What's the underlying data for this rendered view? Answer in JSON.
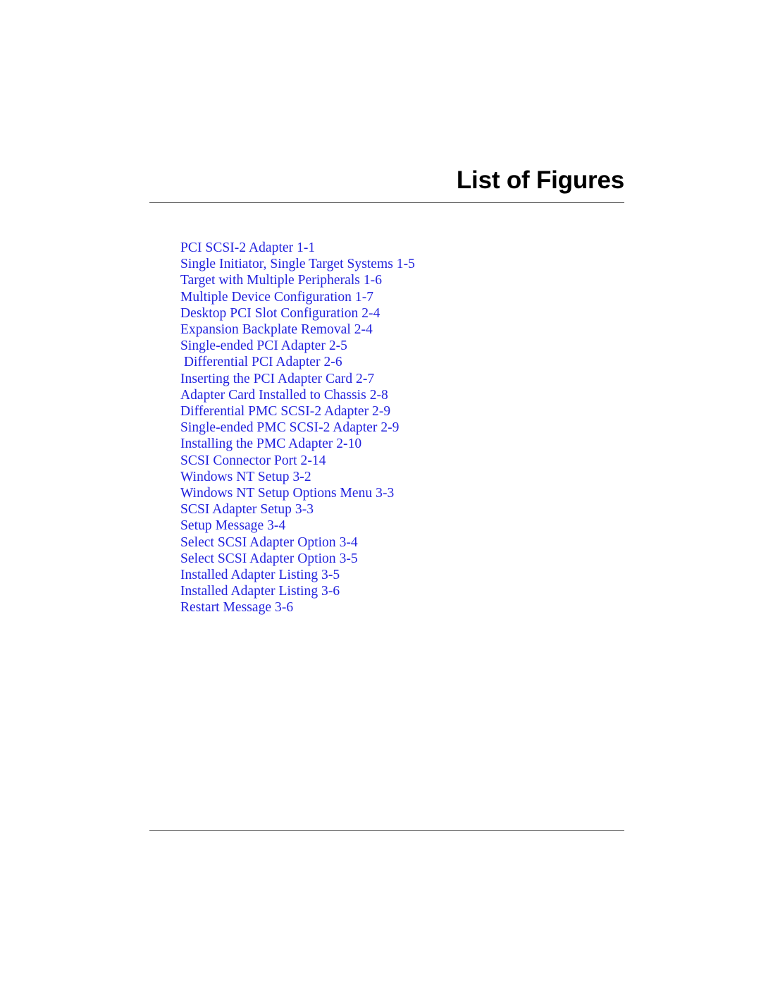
{
  "document": {
    "title": "List of Figures",
    "accent_color": "#2222dd",
    "rule_color": "#4d4d4d",
    "background_color": "#ffffff",
    "title_color": "#000000"
  },
  "figure_list": [
    {
      "label": "PCI SCSI-2 Adapter 1-1"
    },
    {
      "label": "Single Initiator, Single Target Systems 1-5"
    },
    {
      "label": "Target with Multiple Peripherals 1-6"
    },
    {
      "label": "Multiple Device Configuration 1-7"
    },
    {
      "label": "Desktop PCI Slot Configuration 2-4"
    },
    {
      "label": "Expansion Backplate Removal 2-4"
    },
    {
      "label": "Single-ended PCI Adapter 2-5"
    },
    {
      "label": " Differential PCI Adapter 2-6"
    },
    {
      "label": "Inserting the PCI Adapter Card 2-7"
    },
    {
      "label": "Adapter Card Installed to Chassis 2-8"
    },
    {
      "label": "Differential PMC SCSI-2 Adapter 2-9"
    },
    {
      "label": "Single-ended PMC SCSI-2 Adapter 2-9"
    },
    {
      "label": "Installing the PMC Adapter 2-10"
    },
    {
      "label": "SCSI Connector Port 2-14"
    },
    {
      "label": "Windows NT Setup 3-2"
    },
    {
      "label": "Windows NT Setup Options Menu 3-3"
    },
    {
      "label": "SCSI Adapter Setup 3-3"
    },
    {
      "label": "Setup Message 3-4"
    },
    {
      "label": "Select SCSI Adapter Option 3-4"
    },
    {
      "label": "Select SCSI Adapter Option 3-5"
    },
    {
      "label": "Installed Adapter Listing 3-5"
    },
    {
      "label": "Installed Adapter Listing 3-6"
    },
    {
      "label": "Restart Message 3-6"
    }
  ]
}
